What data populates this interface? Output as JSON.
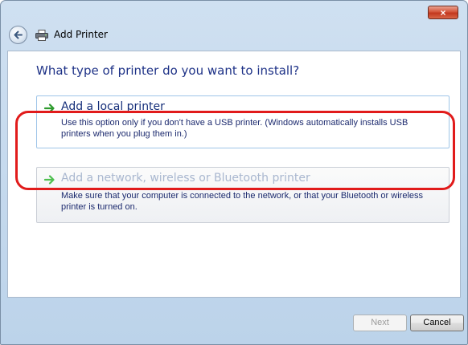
{
  "window": {
    "title": "Add Printer",
    "close_label": "×"
  },
  "main": {
    "heading": "What type of printer do you want to install?",
    "options": [
      {
        "label": "Add a local printer",
        "description": "Use this option only if you don't have a USB printer. (Windows automatically installs USB printers when you plug them in.)"
      },
      {
        "label": "Add a network, wireless or Bluetooth printer",
        "description": "Make sure that your computer is connected to the network, or that your Bluetooth or wireless printer is turned on."
      }
    ]
  },
  "footer": {
    "next_label": "Next",
    "cancel_label": "Cancel"
  },
  "colors": {
    "heading": "#1e3287",
    "highlight": "#e11b1b",
    "arrow": "#2e9b2e"
  },
  "icons": [
    "back-arrow-icon",
    "printer-icon",
    "close-icon",
    "green-arrow-icon"
  ]
}
